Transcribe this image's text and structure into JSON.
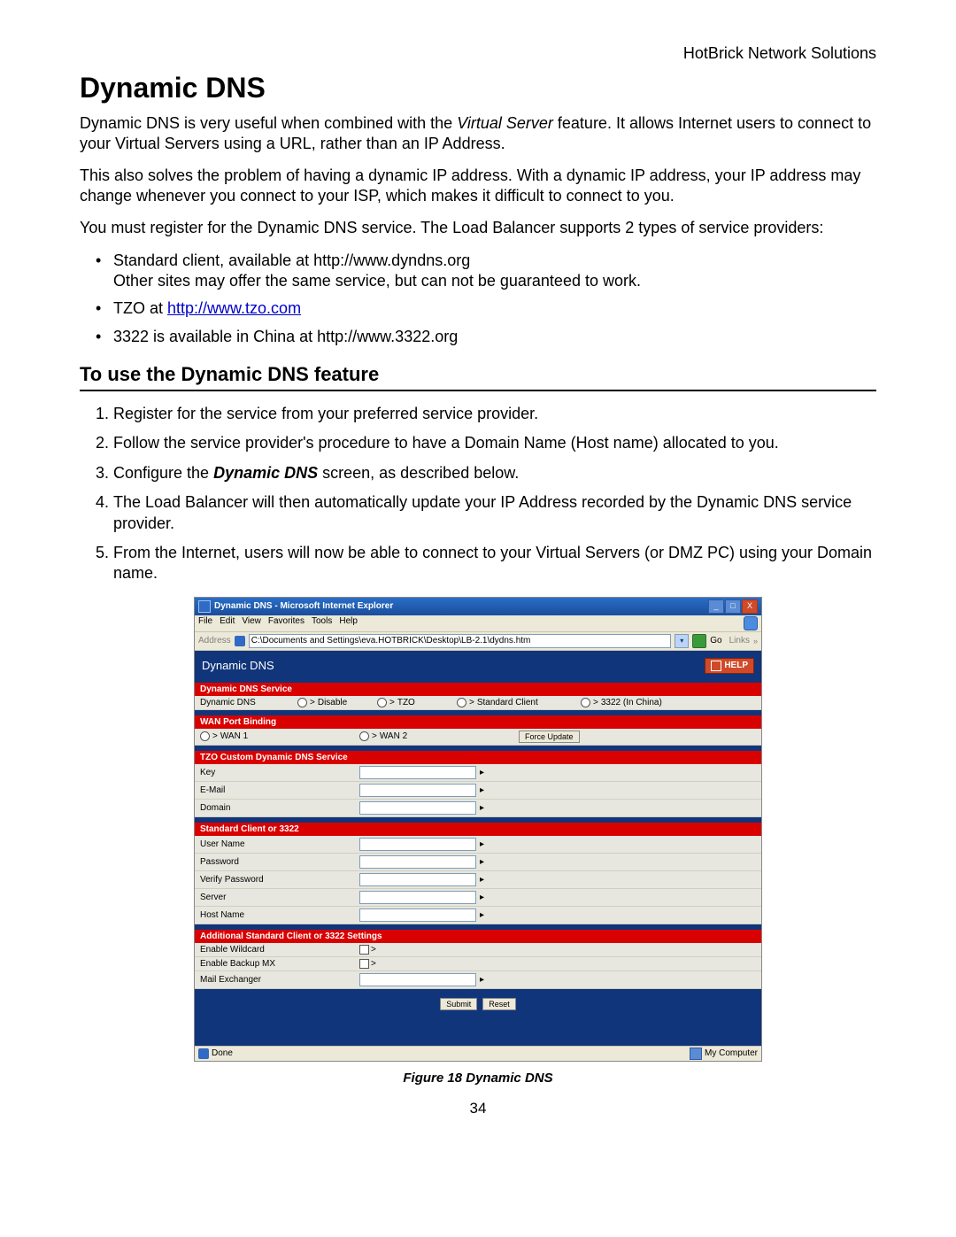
{
  "doc": {
    "header_right": "HotBrick Network Solutions",
    "h1": "Dynamic DNS",
    "p1_a": "Dynamic DNS is very useful when combined with the ",
    "p1_em": "Virtual Server",
    "p1_b": " feature. It allows Internet users to connect to your Virtual Servers using a URL, rather than an IP Address.",
    "p2": "This also solves the problem of having a dynamic IP address. With a dynamic IP address, your IP address may change whenever you connect to your ISP, which makes it difficult to connect to you.",
    "p3": "You must register for the Dynamic DNS service. The Load Balancer supports 2 types of service providers:",
    "bullets": {
      "b1a": "Standard client, available at http://www.dyndns.org",
      "b1b": "Other sites may offer the same service, but can not be guaranteed to work.",
      "b2_pre": "TZO at ",
      "b2_link": "http://www.tzo.com",
      "b3": "3322 is available in China at http://www.3322.org"
    },
    "h2": "To use the Dynamic DNS feature",
    "steps": {
      "s1": "Register for the service from your preferred service provider.",
      "s2": "Follow the service provider's procedure to have a Domain Name (Host name) allocated to you.",
      "s3_a": "Configure the ",
      "s3_b": "Dynamic DNS",
      "s3_c": " screen, as described below.",
      "s4": "The Load Balancer will then automatically update your IP Address recorded by the Dynamic DNS service provider.",
      "s5": "From the Internet, users will now be able to connect to your Virtual Servers (or DMZ PC) using your Domain name."
    },
    "fig_caption": "Figure 18 Dynamic DNS",
    "page_num": "34"
  },
  "ie": {
    "title": "Dynamic DNS - Microsoft Internet Explorer",
    "menus": [
      "File",
      "Edit",
      "View",
      "Favorites",
      "Tools",
      "Help"
    ],
    "addr_label": "Address",
    "addr_value": "C:\\Documents and Settings\\eva.HOTBRICK\\Desktop\\LB-2.1\\dydns.htm",
    "go_label": "Go",
    "links_label": "Links",
    "page_title": "Dynamic DNS",
    "help": "HELP",
    "sections": {
      "s1": "Dynamic DNS Service",
      "s2": "WAN Port Binding",
      "s3": "TZO Custom Dynamic DNS Service",
      "s4": "Standard Client or 3322",
      "s5": "Additional Standard Client or 3322 Settings"
    },
    "row1": {
      "label": "Dynamic DNS",
      "opt1": "Disable",
      "opt2": "TZO",
      "opt3": "Standard Client",
      "opt4": "3322 (In China)"
    },
    "row2": {
      "opt1": "WAN 1",
      "opt2": "WAN 2",
      "btn": "Force Update"
    },
    "tzo": {
      "f1": "Key",
      "f2": "E-Mail",
      "f3": "Domain"
    },
    "std": {
      "f1": "User Name",
      "f2": "Password",
      "f3": "Verify Password",
      "f4": "Server",
      "f5": "Host Name"
    },
    "add": {
      "f1": "Enable Wildcard",
      "f2": "Enable Backup MX",
      "f3": "Mail Exchanger"
    },
    "btns": {
      "submit": "Submit",
      "reset": "Reset"
    },
    "status": {
      "done": "Done",
      "zone": "My Computer"
    }
  }
}
